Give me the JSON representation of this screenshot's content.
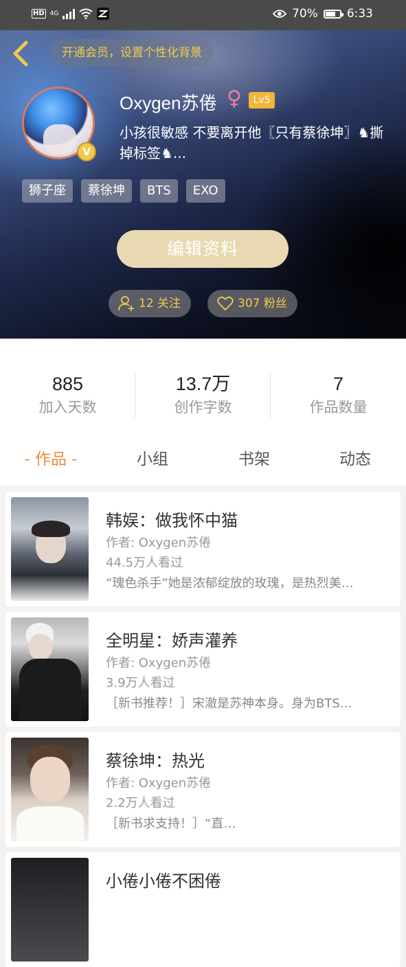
{
  "status_bar": {
    "hd": "HD",
    "network": "4G",
    "battery_percent": "70%",
    "time": "6:33"
  },
  "header": {
    "member_promo": "开通会员，设置个性化背景",
    "username": "Oxygen苏倦",
    "gender_symbol": "♀",
    "level": "Lv5",
    "vip_badge": "V",
    "bio": "小孩很敏感 不要离开他〖只有蔡徐坤〗♞撕掉标签♞...",
    "tags": [
      "狮子座",
      "蔡徐坤",
      "BTS",
      "EXO"
    ],
    "edit_button": "编辑资料",
    "following": "12 关注",
    "fans": "307 粉丝"
  },
  "stats": [
    {
      "value": "885",
      "label": "加入天数"
    },
    {
      "value": "13.7万",
      "label": "创作字数"
    },
    {
      "value": "7",
      "label": "作品数量"
    }
  ],
  "tabs": [
    "- 作品 -",
    "小组",
    "书架",
    "动态"
  ],
  "works": [
    {
      "title": "韩娱：做我怀中猫",
      "author": "作者: Oxygen苏倦",
      "views": "44.5万人看过",
      "desc": "“瑰色杀手”她是浓郁绽放的玫瑰，是热烈美…"
    },
    {
      "title": "全明星：娇声灌养",
      "author": "作者: Oxygen苏倦",
      "views": "3.9万人看过",
      "desc": "［新书推荐！］宋澈是苏神本身。身为BTS…"
    },
    {
      "title": "蔡徐坤：热光",
      "author": "作者: Oxygen苏倦",
      "views": "2.2万人看过",
      "desc": "［新书求支持！］“直…"
    },
    {
      "title": "小倦小倦不困倦",
      "author": "",
      "views": "",
      "desc": ""
    }
  ],
  "colors": {
    "accent_orange": "#f08a3c",
    "gold": "#f2c94c",
    "edit_button_bg": "#e9d9b2"
  }
}
